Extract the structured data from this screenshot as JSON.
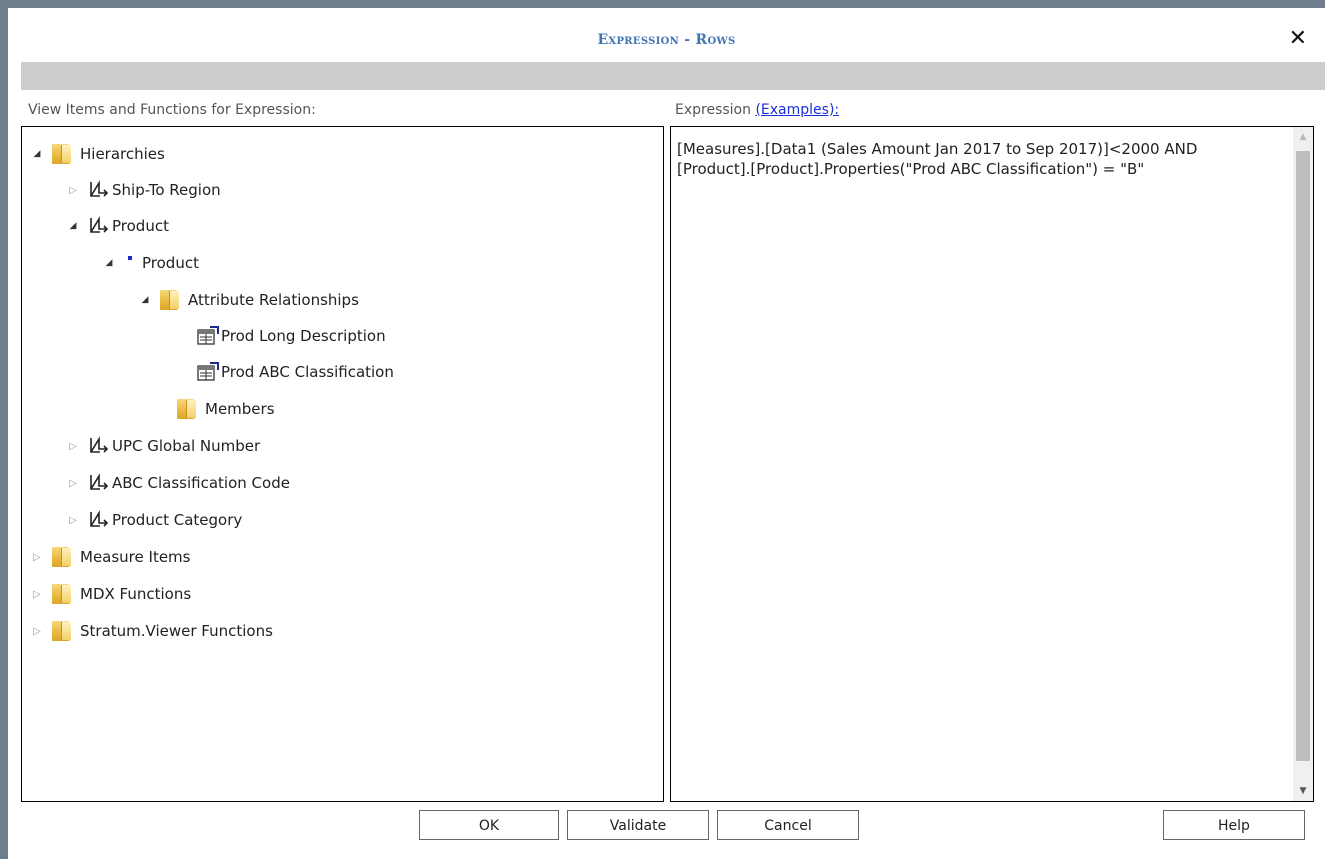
{
  "dialog": {
    "title": "Expression - Rows",
    "close_label": "✕"
  },
  "left_pane": {
    "label": "View Items and Functions for Expression:",
    "tree": [
      {
        "label": "Hierarchies",
        "icon": "folder-icon",
        "state": "expanded"
      },
      {
        "label": "Ship-To Region",
        "icon": "hierarchy-icon",
        "state": "collapsed"
      },
      {
        "label": "Product",
        "icon": "hierarchy-icon",
        "state": "expanded"
      },
      {
        "label": "Product",
        "icon": "level-dot-icon",
        "state": "expanded"
      },
      {
        "label": "Attribute Relationships",
        "icon": "folder-icon",
        "state": "expanded"
      },
      {
        "label": "Prod Long Description",
        "icon": "property-icon",
        "state": "leaf"
      },
      {
        "label": "Prod ABC Classification",
        "icon": "property-icon",
        "state": "leaf"
      },
      {
        "label": "Members",
        "icon": "folder-icon",
        "state": "leaf"
      },
      {
        "label": "UPC Global Number",
        "icon": "hierarchy-icon",
        "state": "collapsed"
      },
      {
        "label": "ABC Classification Code",
        "icon": "hierarchy-icon",
        "state": "collapsed"
      },
      {
        "label": "Product Category",
        "icon": "hierarchy-icon",
        "state": "collapsed"
      },
      {
        "label": "Measure Items",
        "icon": "folder-icon",
        "state": "collapsed"
      },
      {
        "label": "MDX Functions",
        "icon": "folder-icon",
        "state": "collapsed"
      },
      {
        "label": "Stratum.Viewer Functions",
        "icon": "folder-icon",
        "state": "collapsed"
      }
    ]
  },
  "right_pane": {
    "label": "Expression",
    "examples_link": "(Examples):",
    "expression_line1": "[Measures].[Data1 (Sales Amount Jan 2017 to Sep 2017)]<2000 AND",
    "expression_line2": "[Product].[Product].Properties(\"Prod ABC Classification\") = \"B\""
  },
  "buttons": {
    "ok": "OK",
    "validate": "Validate",
    "cancel": "Cancel",
    "help": "Help"
  },
  "colors": {
    "title": "#3f74b4",
    "link": "#1a2fd8",
    "backdrop": "#6f7d8c",
    "strip": "#cccccc"
  }
}
